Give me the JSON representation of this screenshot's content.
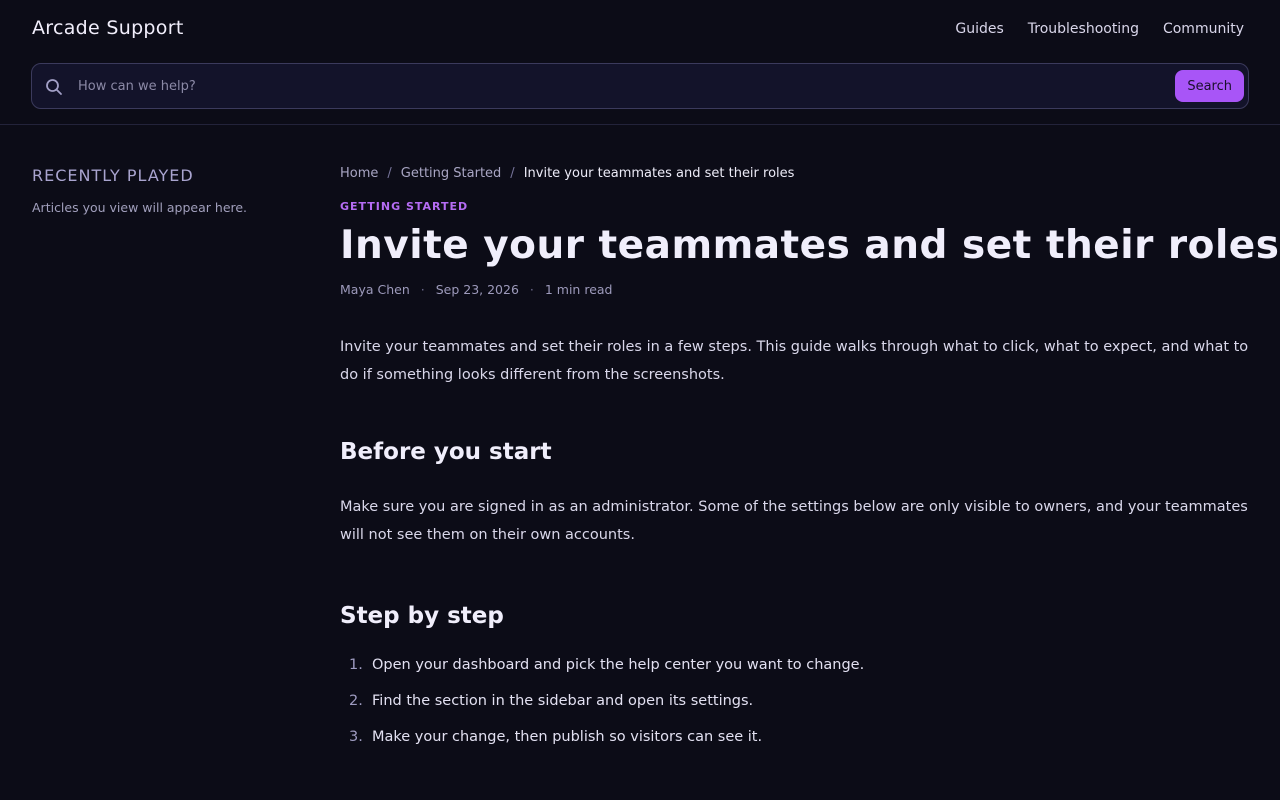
{
  "header": {
    "brand": "Arcade Support",
    "nav": [
      "Guides",
      "Troubleshooting",
      "Community"
    ],
    "search": {
      "placeholder": "How can we help?",
      "button_label": "Search"
    }
  },
  "sidebar": {
    "title": "RECENTLY PLAYED",
    "note": "Articles you view will appear here."
  },
  "article": {
    "breadcrumb": {
      "home": "Home",
      "section": "Getting Started",
      "current": "Invite your teammates and set their roles"
    },
    "category": "GETTING STARTED",
    "title": "Invite your teammates and set their roles",
    "author": "Maya Chen",
    "date": "Sep 23, 2026",
    "read_time": "1 min read",
    "intro": "Invite your teammates and set their roles in a few steps. This guide walks through what to click, what to expect, and what to do if something looks different from the screenshots.",
    "section1": {
      "heading": "Before you start",
      "body": "Make sure you are signed in as an administrator. Some of the settings below are only visible to owners, and your teammates will not see them on their own accounts."
    },
    "section2": {
      "heading": "Step by step",
      "steps": [
        {
          "num": "1.",
          "text": "Open your dashboard and pick the help center you want to change."
        },
        {
          "num": "2.",
          "text": "Find the section in the sidebar and open its settings."
        },
        {
          "num": "3.",
          "text": "Make your change, then publish so visitors can see it."
        }
      ]
    }
  },
  "colors": {
    "background": "#0c0c17",
    "accent": "#a855f7",
    "category": "#b56cf4",
    "border": "#3b3a5c"
  },
  "icons": {
    "search": "search-icon"
  }
}
